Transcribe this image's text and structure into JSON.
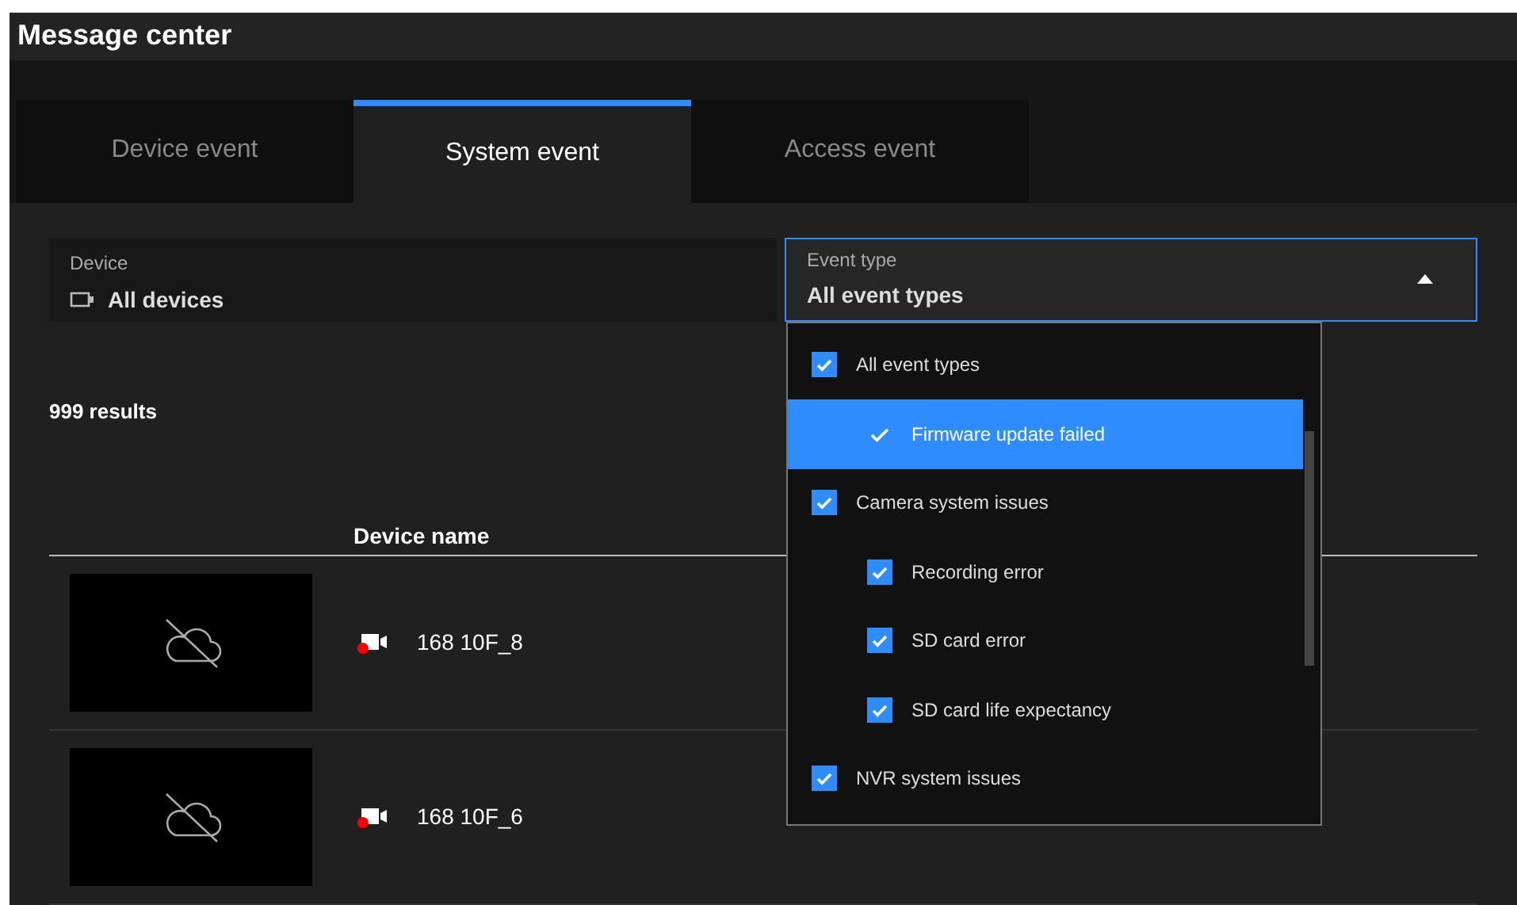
{
  "window": {
    "title": "Message center"
  },
  "tabs": [
    {
      "label": "Device event",
      "selected": false
    },
    {
      "label": "System event",
      "selected": true
    },
    {
      "label": "Access event",
      "selected": false
    }
  ],
  "filters": {
    "device": {
      "label": "Device",
      "value": "All devices"
    },
    "event_type": {
      "label": "Event type",
      "value": "All event types",
      "expanded": true
    }
  },
  "event_type_options": [
    {
      "label": "All event types",
      "checked": true,
      "selected": false,
      "children": [
        {
          "label": "Firmware update failed",
          "checked": true,
          "selected": true
        }
      ]
    },
    {
      "label": "Camera system issues",
      "checked": true,
      "selected": false,
      "children": [
        {
          "label": "Recording error",
          "checked": true,
          "selected": false
        },
        {
          "label": "SD card error",
          "checked": true,
          "selected": false
        },
        {
          "label": "SD card life expectancy",
          "checked": true,
          "selected": false
        }
      ]
    },
    {
      "label": "NVR system issues",
      "checked": true,
      "selected": false
    }
  ],
  "results": "999 results",
  "table": {
    "columns": [
      "Device name"
    ],
    "rows": [
      {
        "device_name": "168 10F_8"
      },
      {
        "device_name": "168 10F_6"
      }
    ]
  }
}
